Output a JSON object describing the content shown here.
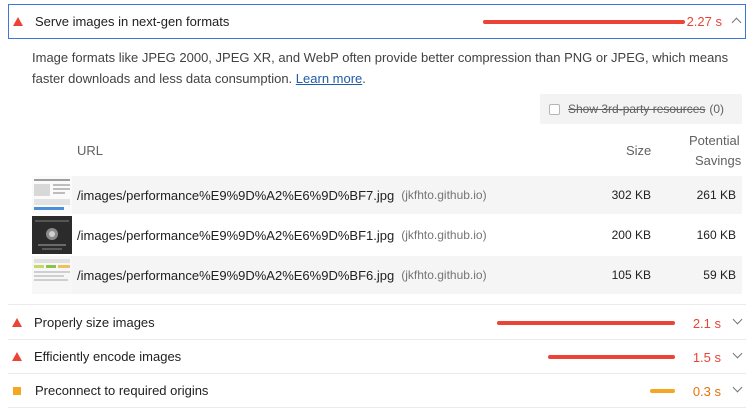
{
  "audits": [
    {
      "title": "Serve images in next-gen formats",
      "value": "2.27 s",
      "severity": "fail",
      "bar_fraction": 0.85
    },
    {
      "title": "Properly size images",
      "value": "2.1 s",
      "severity": "fail",
      "bar_fraction": 0.79
    },
    {
      "title": "Efficiently encode images",
      "value": "1.5 s",
      "severity": "fail",
      "bar_fraction": 0.56
    },
    {
      "title": "Preconnect to required origins",
      "value": "0.3 s",
      "severity": "average",
      "bar_fraction": 0.11
    }
  ],
  "description": {
    "text": "Image formats like JPEG 2000, JPEG XR, and WebP often provide better compression than PNG or JPEG, which means faster downloads and less data consumption.",
    "link": "Learn more",
    "end": "."
  },
  "third_party": {
    "label": "Show 3rd-party resources",
    "count": "(0)"
  },
  "table": {
    "headers": {
      "url": "URL",
      "size": "Size",
      "savings_line1": "Potential",
      "savings_line2": "Savings"
    },
    "rows": [
      {
        "url": "/images/performance%E9%9D%A2%E6%9D%BF7.jpg",
        "host": "(jkfhto.github.io)",
        "size": "302 KB",
        "savings": "261 KB"
      },
      {
        "url": "/images/performance%E9%9D%A2%E6%9D%BF1.jpg",
        "host": "(jkfhto.github.io)",
        "size": "200 KB",
        "savings": "160 KB"
      },
      {
        "url": "/images/performance%E9%9D%A2%E6%9D%BF6.jpg",
        "host": "(jkfhto.github.io)",
        "size": "105 KB",
        "savings": "59 KB"
      }
    ]
  },
  "colors": {
    "fail": "#eb4335",
    "average": "#f5a623",
    "accent": "#3d78d8",
    "link": "#1e5ba8"
  }
}
